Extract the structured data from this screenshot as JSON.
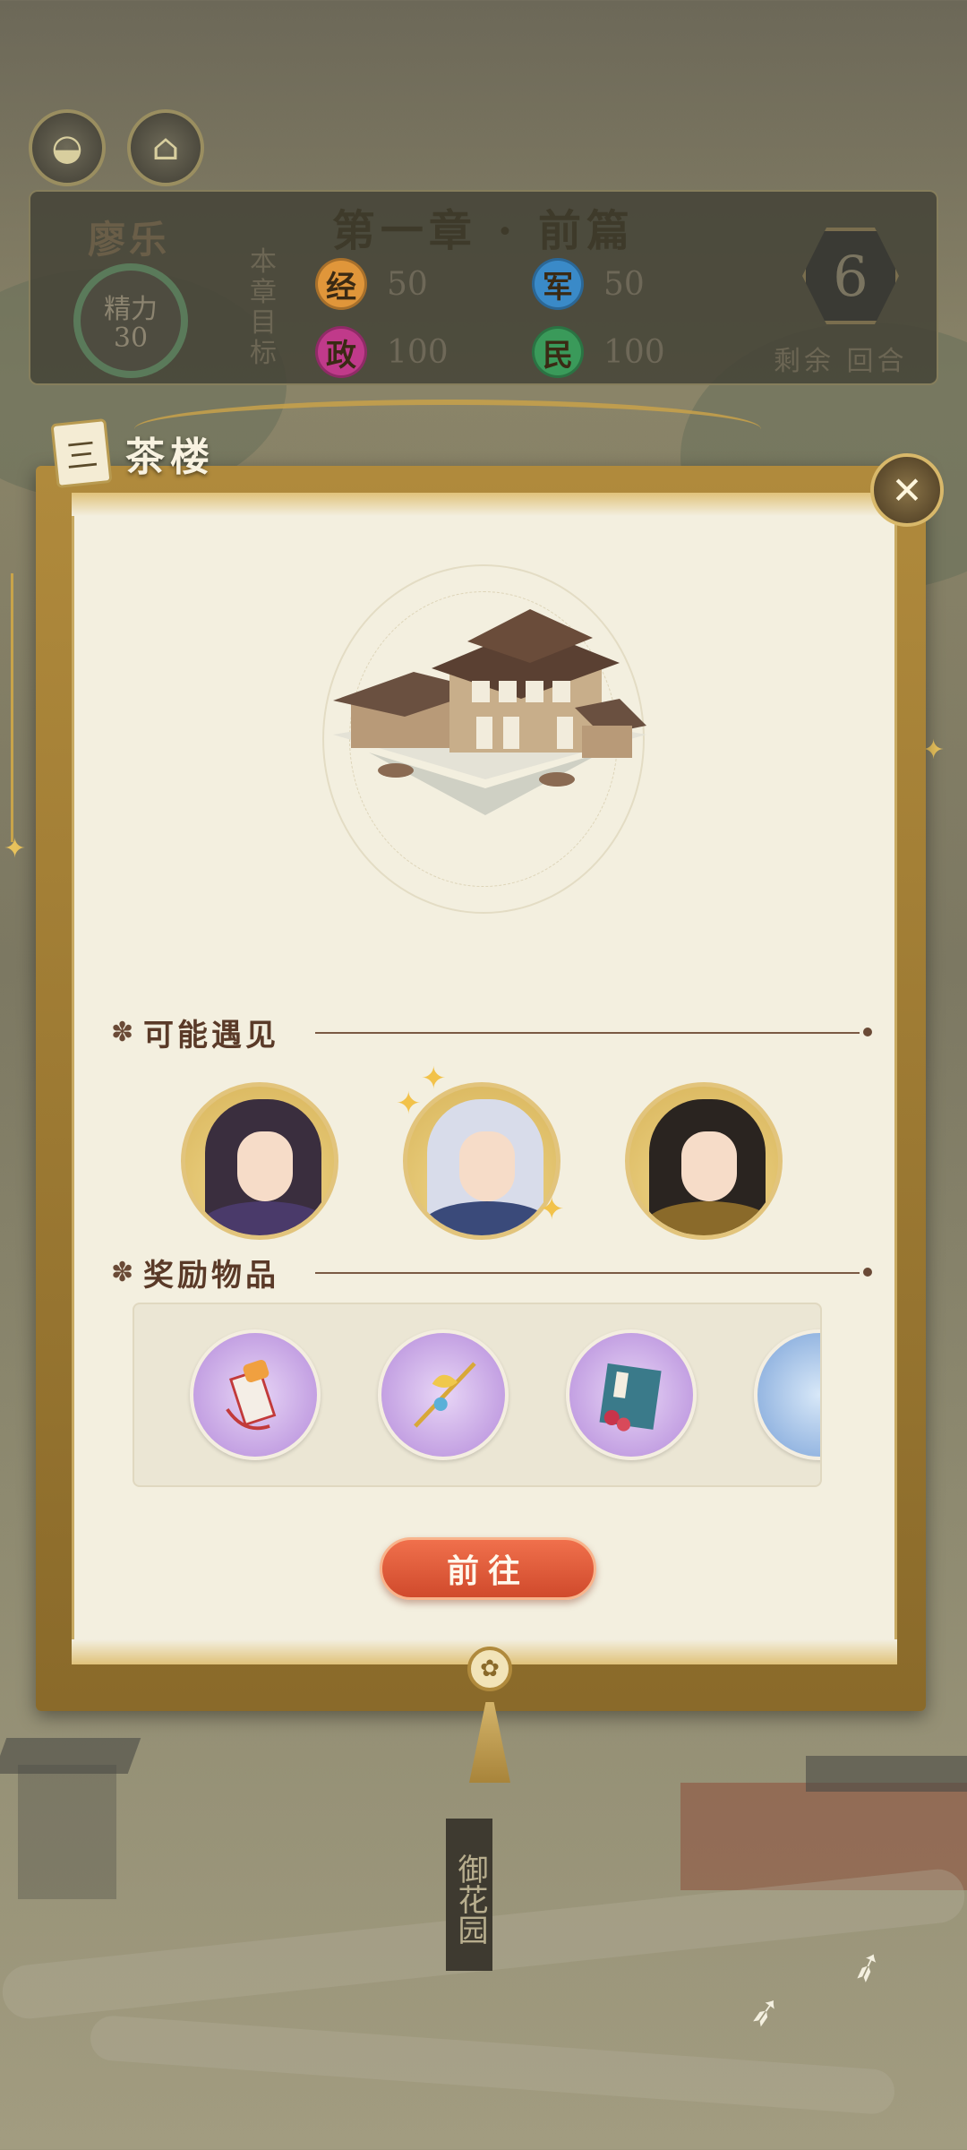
{
  "hud": {
    "chapter_title": "第一章 · 前篇",
    "character_name": "廖乐",
    "energy_label": "精力",
    "energy_value": "30",
    "goal_label": "本章目标",
    "stats": [
      {
        "key": "经",
        "value": "50",
        "color": "#e0963a"
      },
      {
        "key": "军",
        "value": "50",
        "color": "#3a8ac8"
      },
      {
        "key": "政",
        "value": "100",
        "color": "#c03a8a"
      },
      {
        "key": "民",
        "value": "100",
        "color": "#3a9a5a"
      }
    ],
    "rounds_value": "6",
    "rounds_label": "剩余 回合"
  },
  "location": {
    "icon_glyph": "三",
    "title": "茶楼"
  },
  "sections": {
    "encounter_title": "可能遇见",
    "rewards_title": "奖励物品"
  },
  "encounters": [
    {
      "name": "character-1",
      "hair": "#3a2e3e",
      "robe": "#4a3a6a"
    },
    {
      "name": "character-2",
      "hair": "#d8dcea",
      "robe": "#3a4a7a"
    },
    {
      "name": "character-3",
      "hair": "#2a2420",
      "robe": "#8a6a2a"
    }
  ],
  "rewards": [
    {
      "name": "seal-item"
    },
    {
      "name": "hairpin-item"
    },
    {
      "name": "book-item"
    },
    {
      "name": "partial-item"
    }
  ],
  "action": {
    "go_label": "前往"
  },
  "map": {
    "garden_label": "御花园"
  }
}
